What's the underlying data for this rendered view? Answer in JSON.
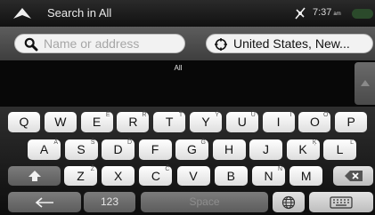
{
  "topbar": {
    "title": "Search in All",
    "time": "7:37",
    "ampm": "am"
  },
  "search": {
    "placeholder": "Name or address",
    "location": "United States, New..."
  },
  "results": {
    "category_label": "All"
  },
  "keyboard": {
    "row1": [
      {
        "key": "Q",
        "alt": ""
      },
      {
        "key": "W",
        "alt": ""
      },
      {
        "key": "E",
        "alt": "É"
      },
      {
        "key": "R",
        "alt": "Ř"
      },
      {
        "key": "T",
        "alt": "Ť"
      },
      {
        "key": "Y",
        "alt": "Ý"
      },
      {
        "key": "U",
        "alt": "Ü"
      },
      {
        "key": "I",
        "alt": "Í"
      },
      {
        "key": "O",
        "alt": "Ö"
      },
      {
        "key": "P",
        "alt": ""
      }
    ],
    "row2": [
      {
        "key": "A",
        "alt": "Á"
      },
      {
        "key": "S",
        "alt": "Š"
      },
      {
        "key": "D",
        "alt": "Ď"
      },
      {
        "key": "F",
        "alt": ""
      },
      {
        "key": "G",
        "alt": "Ğ"
      },
      {
        "key": "H",
        "alt": ""
      },
      {
        "key": "J",
        "alt": ""
      },
      {
        "key": "K",
        "alt": "Ķ"
      },
      {
        "key": "L",
        "alt": "Ľ"
      }
    ],
    "row3": [
      {
        "key": "Z",
        "alt": "Ž"
      },
      {
        "key": "X",
        "alt": ""
      },
      {
        "key": "C",
        "alt": "Č"
      },
      {
        "key": "V",
        "alt": ""
      },
      {
        "key": "B",
        "alt": ""
      },
      {
        "key": "N",
        "alt": "Ň"
      },
      {
        "key": "M",
        "alt": ""
      }
    ],
    "numbers_label": "123",
    "space_label": "Space",
    "icons": {
      "shift": "shift-icon",
      "backspace": "backspace-icon",
      "back": "back-arrow-icon",
      "globe": "globe-icon",
      "keyboard": "keyboard-icon"
    }
  },
  "colors": {
    "topbar": "#111111",
    "search_bar": "#4a4a4a",
    "key": "#f2f2f2",
    "dark_key": "#6b6b6b"
  }
}
